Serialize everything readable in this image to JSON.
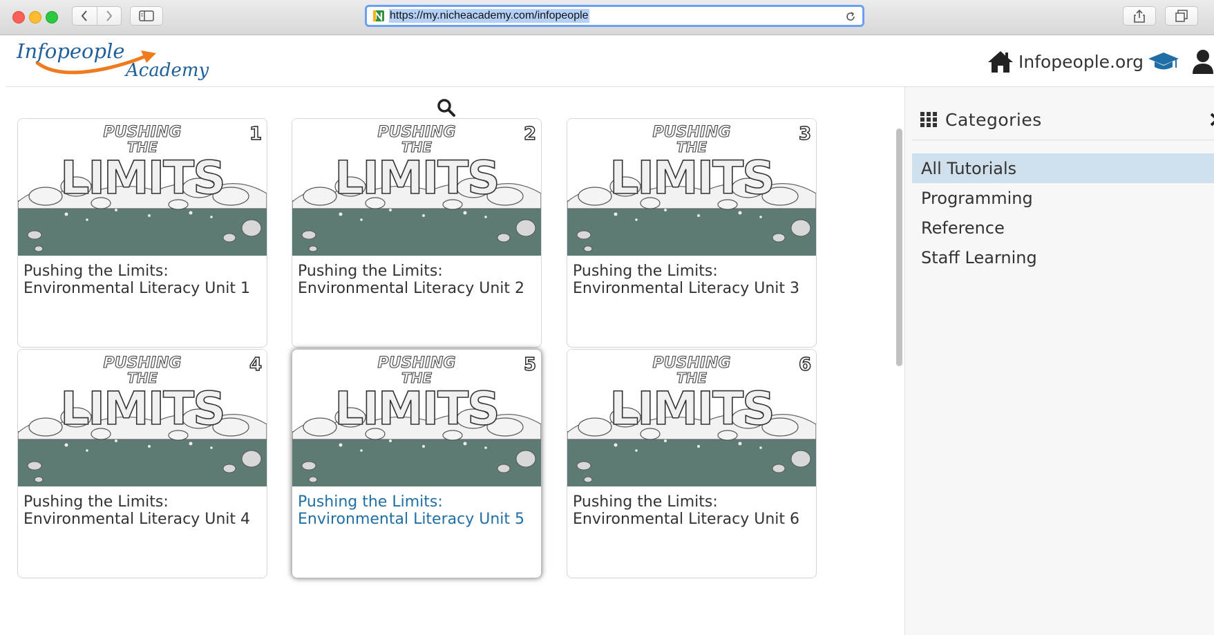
{
  "browser": {
    "url": "https://my.nicheacademy.com/infopeople"
  },
  "header": {
    "logo_line1": "Infopeople",
    "logo_line2": "Academy",
    "home_link": "Infopeople.org"
  },
  "cards": [
    {
      "title_line1": "Pushing the Limits:",
      "title_line2": "Environmental Literacy Unit 1",
      "unit_number": "1"
    },
    {
      "title_line1": "Pushing the Limits:",
      "title_line2": "Environmental Literacy Unit 2",
      "unit_number": "2"
    },
    {
      "title_line1": "Pushing the Limits:",
      "title_line2": "Environmental Literacy Unit 3",
      "unit_number": "3"
    },
    {
      "title_line1": "Pushing the Limits:",
      "title_line2": "Environmental Literacy Unit 4",
      "unit_number": "4"
    },
    {
      "title_line1": "Pushing the Limits:",
      "title_line2": "Environmental Literacy Unit 5",
      "unit_number": "5",
      "hovered": true
    },
    {
      "title_line1": "Pushing the Limits:",
      "title_line2": "Environmental Literacy Unit 6",
      "unit_number": "6"
    }
  ],
  "thumbnail_art": {
    "line1": "PUSHING",
    "line2": "THE",
    "line3": "LIMITS"
  },
  "categories": {
    "title": "Categories",
    "items": [
      {
        "label": "All Tutorials",
        "selected": true
      },
      {
        "label": "Programming",
        "selected": false
      },
      {
        "label": "Reference",
        "selected": false
      },
      {
        "label": "Staff Learning",
        "selected": false
      }
    ]
  },
  "colors": {
    "accent_blue": "#1f6fa6",
    "selected_bg": "#cfe0ec",
    "ground_green": "#5d7b74",
    "logo_orange": "#f07a1e"
  }
}
